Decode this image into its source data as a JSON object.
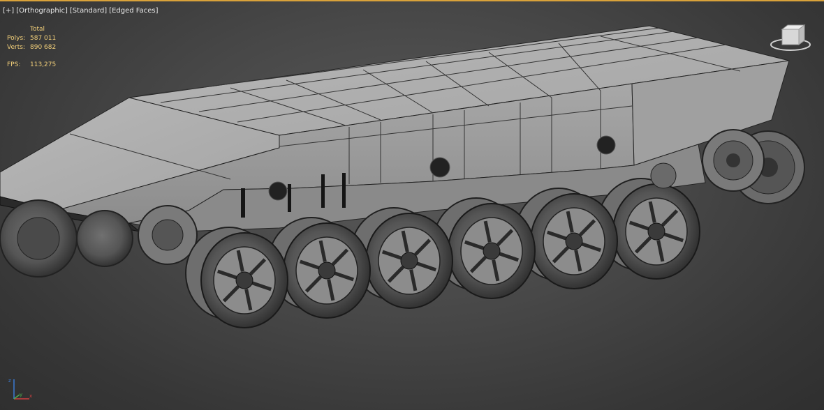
{
  "viewport": {
    "labels": [
      "[+]",
      "[Orthographic]",
      "[Standard]",
      "[Edged Faces]"
    ]
  },
  "stats": {
    "header": "Total",
    "polys_label": "Polys:",
    "polys_value": "587 011",
    "verts_label": "Verts:",
    "verts_value": "890 682",
    "fps_label": "FPS:",
    "fps_value": "113,275"
  },
  "viewcube": {
    "label": ""
  },
  "axis": {
    "x": "x",
    "y": "y",
    "z": "z"
  },
  "colors": {
    "accent_border": "#d9a23a",
    "stats_text": "#f3d07a",
    "model_fill": "#9a9a9a"
  },
  "model": {
    "wheels": 6,
    "description_icon": "tank-hull-mesh"
  }
}
